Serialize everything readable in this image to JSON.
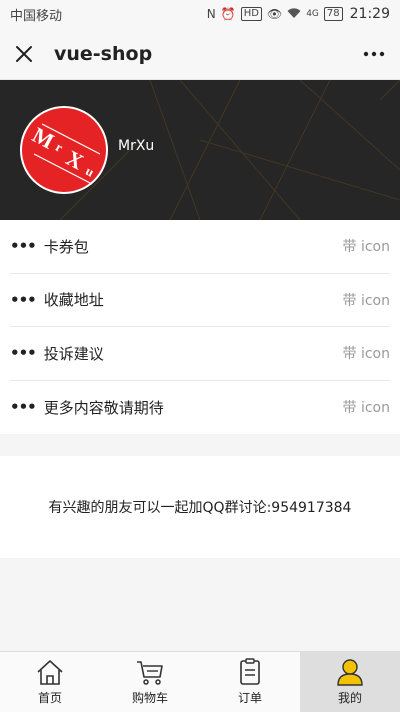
{
  "status_bar": {
    "carrier": "中国移动",
    "nfc_icon": "N",
    "alarm_icon": "alarm-icon",
    "hd_label": "HD",
    "eye_icon": "eye-icon",
    "wifi_icon": "wifi-icon",
    "network_label": "4G",
    "battery_level": "78",
    "time": "21:29"
  },
  "header": {
    "title": "vue-shop"
  },
  "profile": {
    "username": "MrXu",
    "avatar_text": "MrXu",
    "avatar_color": "#e52325"
  },
  "menu": {
    "items": [
      {
        "label": "卡券包",
        "tag": "带 icon"
      },
      {
        "label": "收藏地址",
        "tag": "带 icon"
      },
      {
        "label": "投诉建议",
        "tag": "带 icon"
      },
      {
        "label": "更多内容敬请期待",
        "tag": "带 icon"
      }
    ],
    "dots": "•••"
  },
  "info": {
    "text": "有兴趣的朋友可以一起加QQ群讨论:954917384"
  },
  "tabs": {
    "items": [
      {
        "label": "首页",
        "icon": "home-icon"
      },
      {
        "label": "购物车",
        "icon": "cart-icon"
      },
      {
        "label": "订单",
        "icon": "order-icon"
      },
      {
        "label": "我的",
        "icon": "user-icon",
        "active": true
      }
    ],
    "active_icon_color": "#f2c200"
  }
}
